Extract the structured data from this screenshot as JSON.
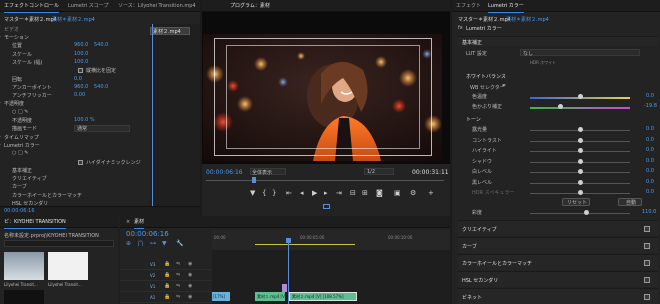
{
  "effect_controls": {
    "tab_label": "エフェクトコントロール",
    "tab2_label": "Lumetri スコープ",
    "tab3_label": "ソース：Lilyohei Transition.mp4",
    "master_clip": "マスター＊素材２.mp4",
    "sequence_clip": "素材＊素材２.mp4",
    "clip_chip": "素材２.mp4",
    "video_header": "ビデオ",
    "rows": [
      {
        "label": "モーション"
      },
      {
        "label": "位置",
        "v1": "960.0",
        "v2": "540.0"
      },
      {
        "label": "スケール",
        "v1": "100.0"
      },
      {
        "label": "スケール (幅)",
        "v1": "100.0"
      },
      {
        "label": "縦横比を固定",
        "check": true
      },
      {
        "label": "回転",
        "v1": "0.0"
      },
      {
        "label": "アンカーポイント",
        "v1": "960.0",
        "v2": "540.0"
      },
      {
        "label": "アンチフリッカー",
        "v1": "0.00"
      },
      {
        "label": "不透明度"
      },
      {
        "label": "○ □ ✎"
      },
      {
        "label": "不透明度",
        "v1": "100.0 %"
      },
      {
        "label": "描画モード",
        "select": "通常"
      },
      {
        "label": "タイムリマップ"
      },
      {
        "label": "Lumetri カラー"
      },
      {
        "label": "○ □ ✎"
      },
      {
        "label": "ハイダイナミックレンジ",
        "check": true
      },
      {
        "label": "基本補正"
      },
      {
        "label": "クリエイティブ"
      },
      {
        "label": "カーブ"
      },
      {
        "label": "カラーホイールとカラーマッチ"
      },
      {
        "label": "HSL セカンダリ"
      }
    ],
    "timecode": "00:00:06:16"
  },
  "program": {
    "tab_label": "プログラム：素材",
    "timecode_left": "00:00:06:16",
    "fit_label": "全体表示",
    "ratio_label": "1/2",
    "timecode_right": "00:00:31:11"
  },
  "project": {
    "tab_label": "ピ：KIYOHEI TRANSITION",
    "path": "名称未設定.prproj\\KIYOHEI TRANSITION",
    "thumbs": [
      {
        "label": "Lilyohei Transit...",
        "duration": "1:08:03"
      },
      {
        "label": "Lilyohei Transit...",
        "duration": "1:08:03"
      },
      {
        "label": "",
        "duration": ""
      }
    ]
  },
  "timeline": {
    "tab_label": "素材",
    "timecode": "00:00:06:16",
    "ruler": [
      "00:00",
      "00:00:05:00",
      "00:00:10:00"
    ],
    "tracks": [
      {
        "name": "V3"
      },
      {
        "name": "V2"
      },
      {
        "name": "V1"
      },
      {
        "name": "A1"
      }
    ],
    "clips": [
      {
        "label": "素材１.mp4 [V]"
      },
      {
        "label": "素材２.mp4 [V] [108.57%]"
      },
      {
        "label": "[17%]"
      }
    ]
  },
  "lumetri": {
    "tab1": "エフェクト",
    "tab2": "Lumetri カラー",
    "master": "マスター＊素材２.mp4",
    "sequence": "素材＊素材２.mp4",
    "fx_label": "Lumetri カラー",
    "basic": "基本補正",
    "lut_label": "LUT 設定",
    "lut_value": "なし",
    "hdr_label": "HDR ホワイト",
    "wb_header": "ホワイトバランス",
    "wb_selector": "WB セレクター",
    "temp_label": "色温度",
    "temp_value": "0.0",
    "tint_label": "色かぶり補正",
    "tint_value": "-19.8",
    "tone_header": "トーン",
    "tone_rows": [
      {
        "label": "露光量",
        "value": "0.0"
      },
      {
        "label": "コントラスト",
        "value": "0.0"
      },
      {
        "label": "ハイライト",
        "value": "0.0"
      },
      {
        "label": "シャドウ",
        "value": "0.0"
      },
      {
        "label": "白レベル",
        "value": "0.0"
      },
      {
        "label": "黒レベル",
        "value": "0.0"
      },
      {
        "label": "HDR スペキュラー",
        "value": "0.0"
      }
    ],
    "reset_label": "リセット",
    "auto_label": "自動",
    "sat_label": "彩度",
    "sat_value": "110.0",
    "sections": [
      "クリエイティブ",
      "カーブ",
      "カラーホイールとカラーマッチ",
      "HSL セカンダリ",
      "ビネット"
    ]
  },
  "colors": {
    "accent": "#2d8ceb",
    "value_blue": "#4a9cf0",
    "clip_green": "#3ba86a",
    "clip_video": "#6bb0d8",
    "clip_audio": "#5fbf92",
    "playhead": "#5a8fd8"
  }
}
